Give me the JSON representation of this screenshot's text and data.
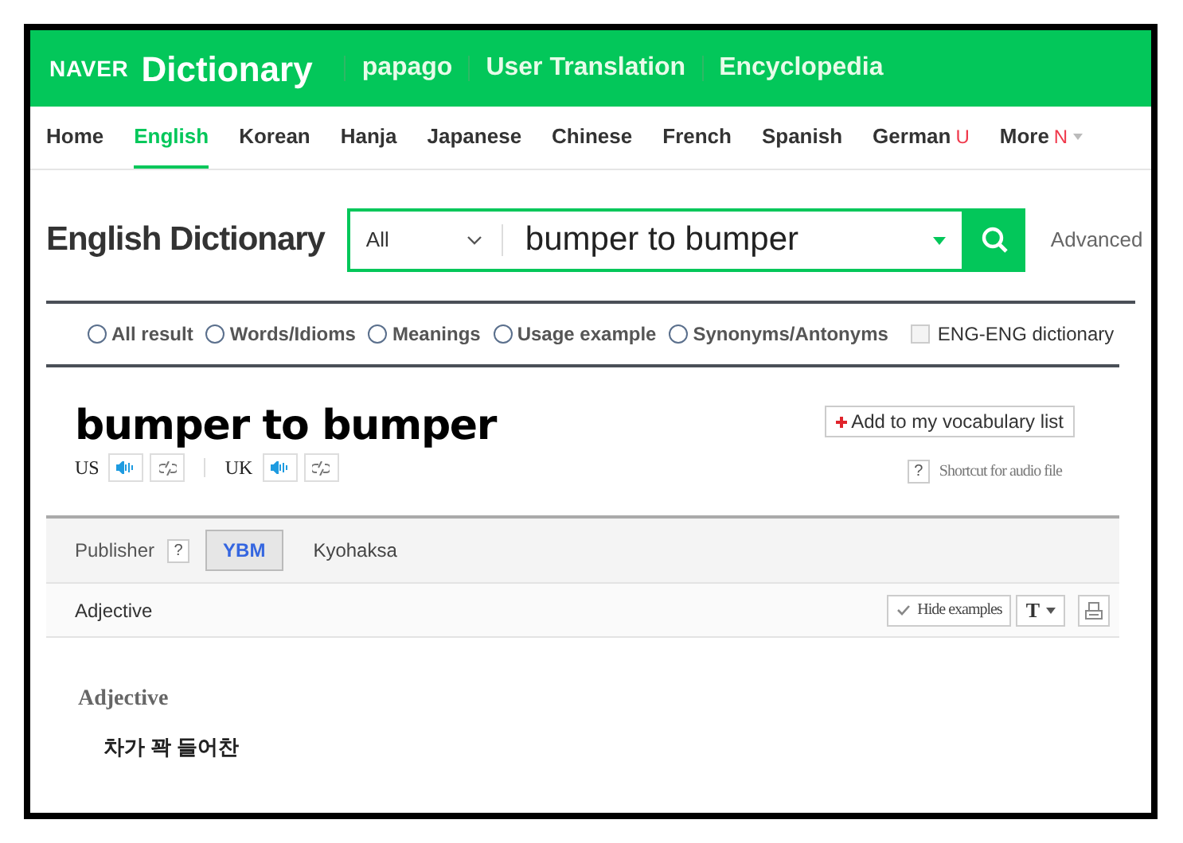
{
  "header": {
    "logo": "NAVER",
    "title": "Dictionary",
    "links": [
      "papago",
      "User Translation",
      "Encyclopedia"
    ]
  },
  "nav": [
    {
      "label": "Home",
      "selected": false
    },
    {
      "label": "English",
      "selected": true
    },
    {
      "label": "Korean",
      "selected": false
    },
    {
      "label": "Hanja",
      "selected": false
    },
    {
      "label": "Japanese",
      "selected": false
    },
    {
      "label": "Chinese",
      "selected": false
    },
    {
      "label": "French",
      "selected": false
    },
    {
      "label": "Spanish",
      "selected": false
    },
    {
      "label": "German",
      "selected": false,
      "badge": "U"
    },
    {
      "label": "More",
      "selected": false,
      "badge": "N",
      "dropdown": true
    }
  ],
  "search": {
    "heading": "English Dictionary",
    "scope": "All",
    "value": "bumper to bumper",
    "advanced": "Advanced"
  },
  "filters": [
    {
      "kind": "radio",
      "label": "All result",
      "selected": false
    },
    {
      "kind": "radio",
      "label": "Words/Idioms",
      "selected": false
    },
    {
      "kind": "radio",
      "label": "Meanings",
      "selected": false
    },
    {
      "kind": "radio",
      "label": "Usage example",
      "selected": false
    },
    {
      "kind": "radio",
      "label": "Synonyms/Antonyms",
      "selected": false
    },
    {
      "kind": "checkbox",
      "label": "ENG-ENG dictionary",
      "checked": false
    }
  ],
  "entry": {
    "word": "bumper to bumper",
    "add_button": "Add to my vocabulary list",
    "pronunciations": [
      "US",
      "UK"
    ],
    "help_mark": "?",
    "shortcut": "Shortcut for audio file"
  },
  "publisher": {
    "label": "Publisher",
    "help_mark": "?",
    "tabs": [
      {
        "label": "YBM",
        "selected": true
      },
      {
        "label": "Kyohaksa",
        "selected": false
      }
    ]
  },
  "toolbar": {
    "part": "Adjective",
    "hide_button": "Hide examples",
    "font_button": "T"
  },
  "meaning": {
    "part": "Adjective",
    "text": "차가 꽉 들어찬"
  }
}
